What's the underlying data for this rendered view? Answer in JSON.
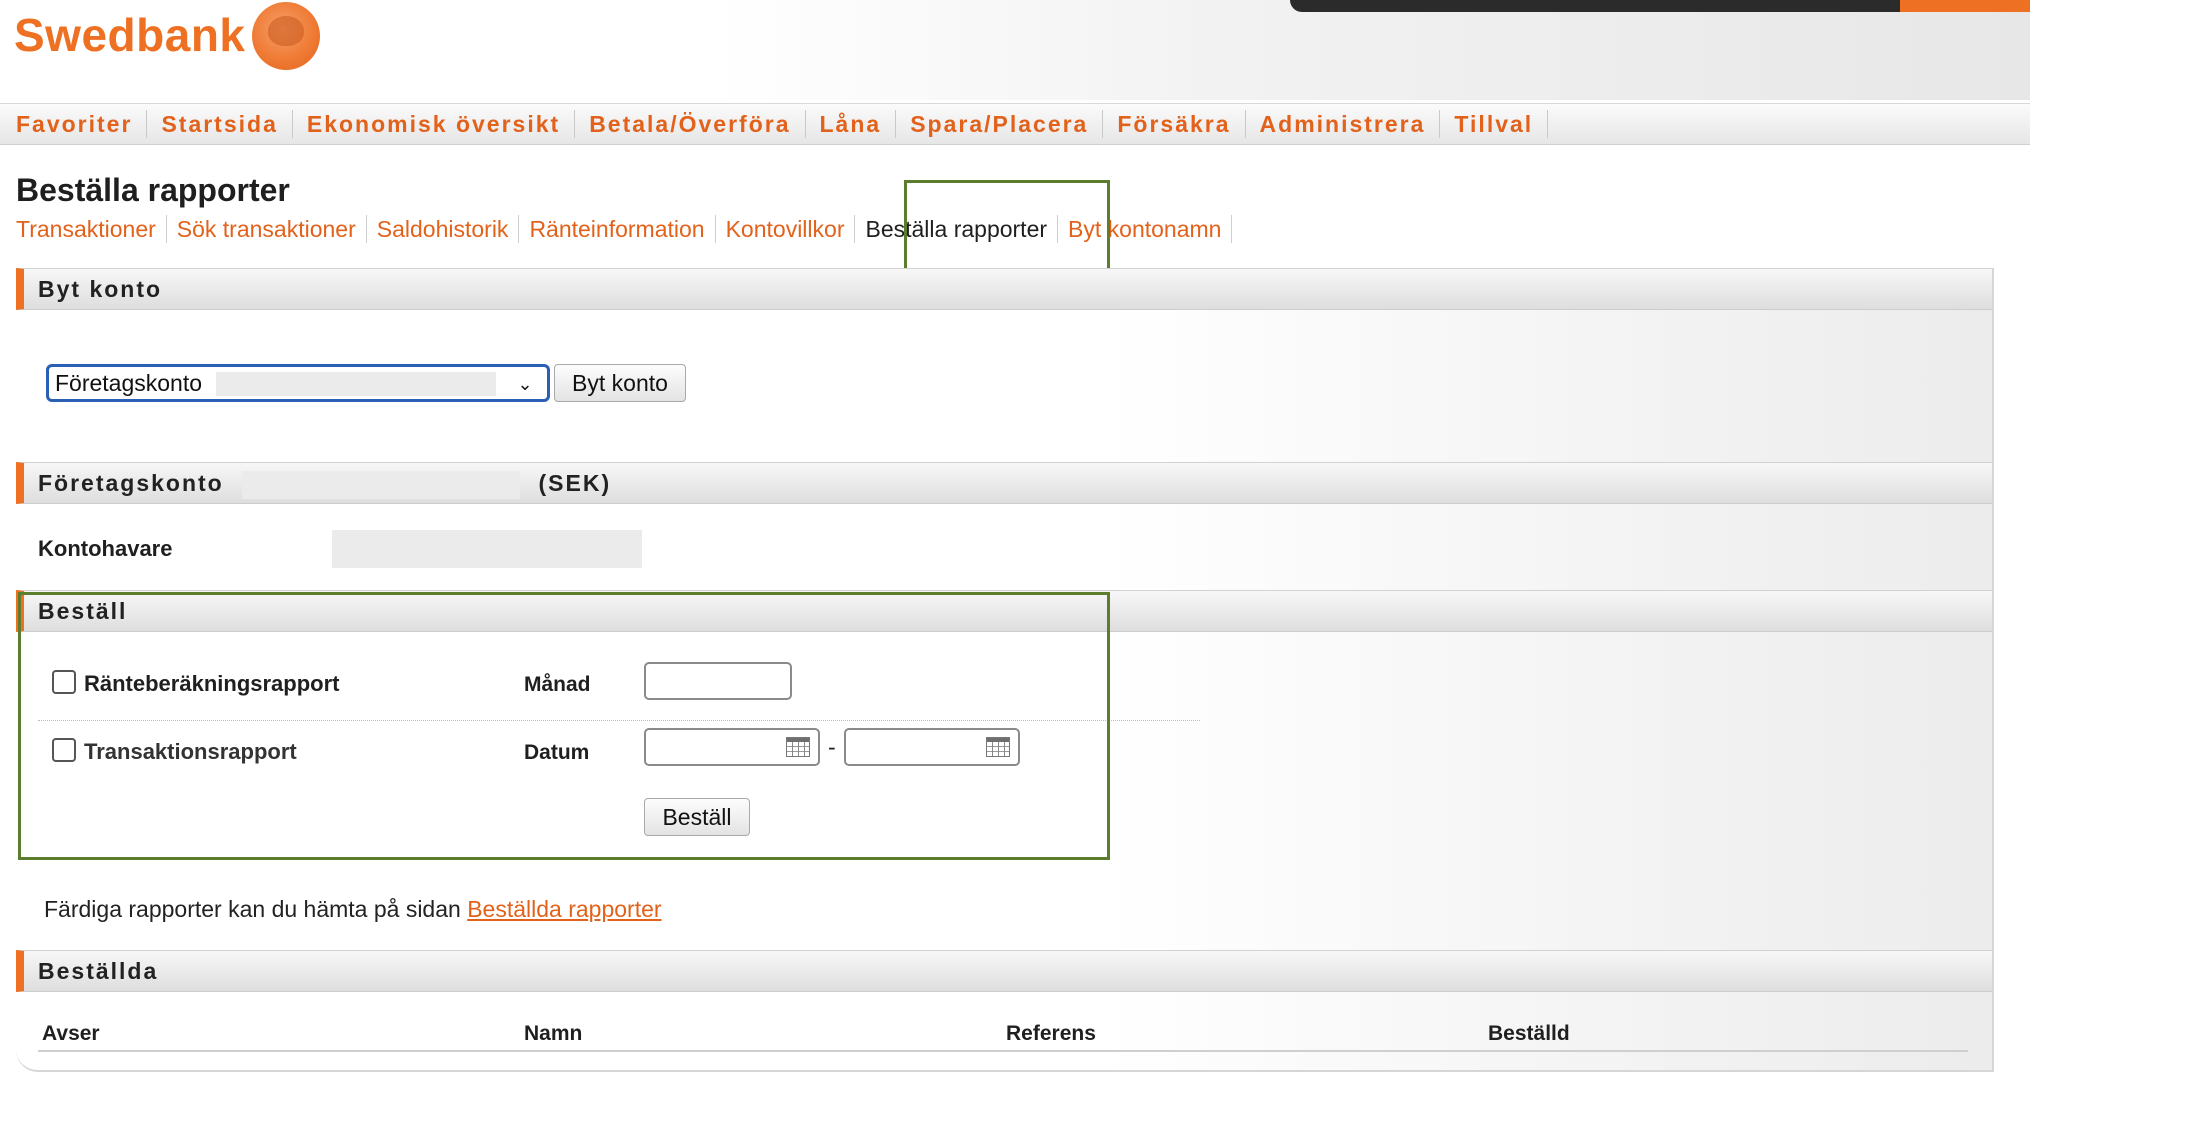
{
  "brand": {
    "name": "Swedbank"
  },
  "main_nav": [
    {
      "label": "Favoriter"
    },
    {
      "label": "Startsida"
    },
    {
      "label": "Ekonomisk översikt"
    },
    {
      "label": "Betala/Överföra"
    },
    {
      "label": "Låna"
    },
    {
      "label": "Spara/Placera"
    },
    {
      "label": "Försäkra"
    },
    {
      "label": "Administrera"
    },
    {
      "label": "Tillval"
    }
  ],
  "page": {
    "title": "Beställa rapporter"
  },
  "sub_nav": [
    {
      "label": "Transaktioner"
    },
    {
      "label": "Sök transaktioner"
    },
    {
      "label": "Saldohistorik"
    },
    {
      "label": "Ränteinformation"
    },
    {
      "label": "Kontovillkor"
    },
    {
      "label": "Beställa rapporter",
      "active": true
    },
    {
      "label": "Byt kontonamn"
    }
  ],
  "switch_account": {
    "title": "Byt konto",
    "selected_account": "Företagskonto",
    "button_label": "Byt konto"
  },
  "account": {
    "title_prefix": "Företagskonto",
    "currency": "(SEK)",
    "holder_label": "Kontohavare"
  },
  "order": {
    "title": "Beställ",
    "interest_report_label": "Ränteberäkningsrapport",
    "month_label": "Månad",
    "transaction_report_label": "Transaktionsrapport",
    "date_label": "Datum",
    "date_separator": "-",
    "submit_label": "Beställ"
  },
  "info": {
    "text": "Färdiga rapporter kan du hämta på sidan",
    "link": "Beställda rapporter"
  },
  "ordered": {
    "title": "Beställda",
    "columns": [
      "Avser",
      "Namn",
      "Referens",
      "Beställd"
    ]
  },
  "colors": {
    "brand_orange": "#ee7023",
    "link_orange": "#e2621b",
    "highlight_green": "#5c7c2e"
  }
}
